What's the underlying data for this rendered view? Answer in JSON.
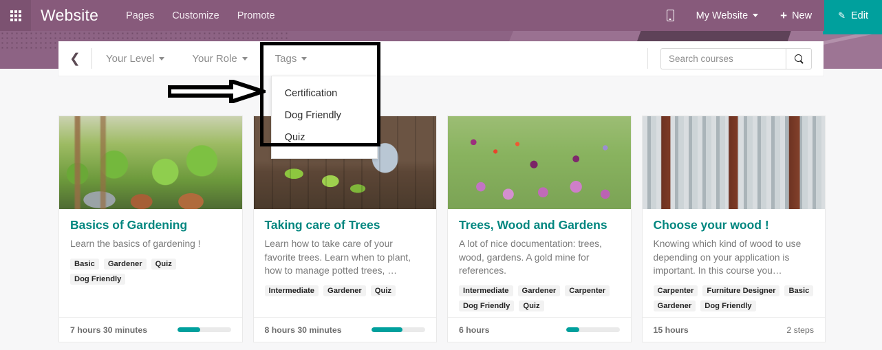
{
  "navbar": {
    "apps_icon": "grid-apps-icon",
    "brand": "Website",
    "links": [
      {
        "label": "Pages"
      },
      {
        "label": "Customize"
      },
      {
        "label": "Promote"
      }
    ],
    "mobile_preview_icon": "mobile-phone-icon",
    "site_selector": "My Website",
    "new_label": "New",
    "new_icon": "plus-icon",
    "edit_label": "Edit",
    "edit_icon": "pencil-icon",
    "bg_color": "#875A7B",
    "edit_color": "#00A09D"
  },
  "filter_bar": {
    "back_icon": "chevron-left-icon",
    "filters": [
      {
        "label": "Your Level"
      },
      {
        "label": "Your Role"
      },
      {
        "label": "Tags"
      }
    ],
    "open_dropdown": {
      "owner": "Tags",
      "items": [
        {
          "label": "Certification"
        },
        {
          "label": "Dog Friendly"
        },
        {
          "label": "Quiz"
        }
      ]
    },
    "search": {
      "placeholder": "Search courses",
      "value": "",
      "button_icon": "search-icon"
    }
  },
  "annotation": {
    "arrow": "right-arrow-outline",
    "highlight": "black-rectangle-around-tags-dropdown"
  },
  "courses": [
    {
      "image": "photo-garden",
      "image_alt": "Potted plants and watering cans in a garden",
      "title": "Basics of Gardening",
      "description": "Learn the basics of gardening !",
      "tags": [
        "Basic",
        "Gardener",
        "Quiz",
        "Dog Friendly"
      ],
      "duration": "7 hours 30 minutes",
      "progress": 43,
      "steps": ""
    },
    {
      "image": "photo-tools",
      "image_alt": "Watering can, seedlings and garden tools on wood",
      "title": "Taking care of Trees",
      "description": "Learn how to take care of your favorite trees. Learn when to plant, how to manage potted trees, …",
      "tags": [
        "Intermediate",
        "Gardener",
        "Quiz"
      ],
      "duration": "8 hours 30 minutes",
      "progress": 58,
      "steps": ""
    },
    {
      "image": "photo-flowers",
      "image_alt": "Meadow of purple and pink wildflowers",
      "title": "Trees, Wood and Gardens",
      "description": "A lot of nice documentation: trees, wood, gardens. A gold mine for references.",
      "tags": [
        "Intermediate",
        "Gardener",
        "Carpenter",
        "Dog Friendly",
        "Quiz"
      ],
      "duration": "6 hours",
      "progress": 25,
      "steps": ""
    },
    {
      "image": "photo-forest",
      "image_alt": "Snow covered redwood forest",
      "title": "Choose your wood !",
      "description": "Knowing which kind of wood to use depending on your application is important. In this course you…",
      "tags": [
        "Carpenter",
        "Furniture Designer",
        "Basic",
        "Gardener",
        "Dog Friendly"
      ],
      "duration": "15 hours",
      "progress": 0,
      "steps": "2 steps"
    }
  ]
}
